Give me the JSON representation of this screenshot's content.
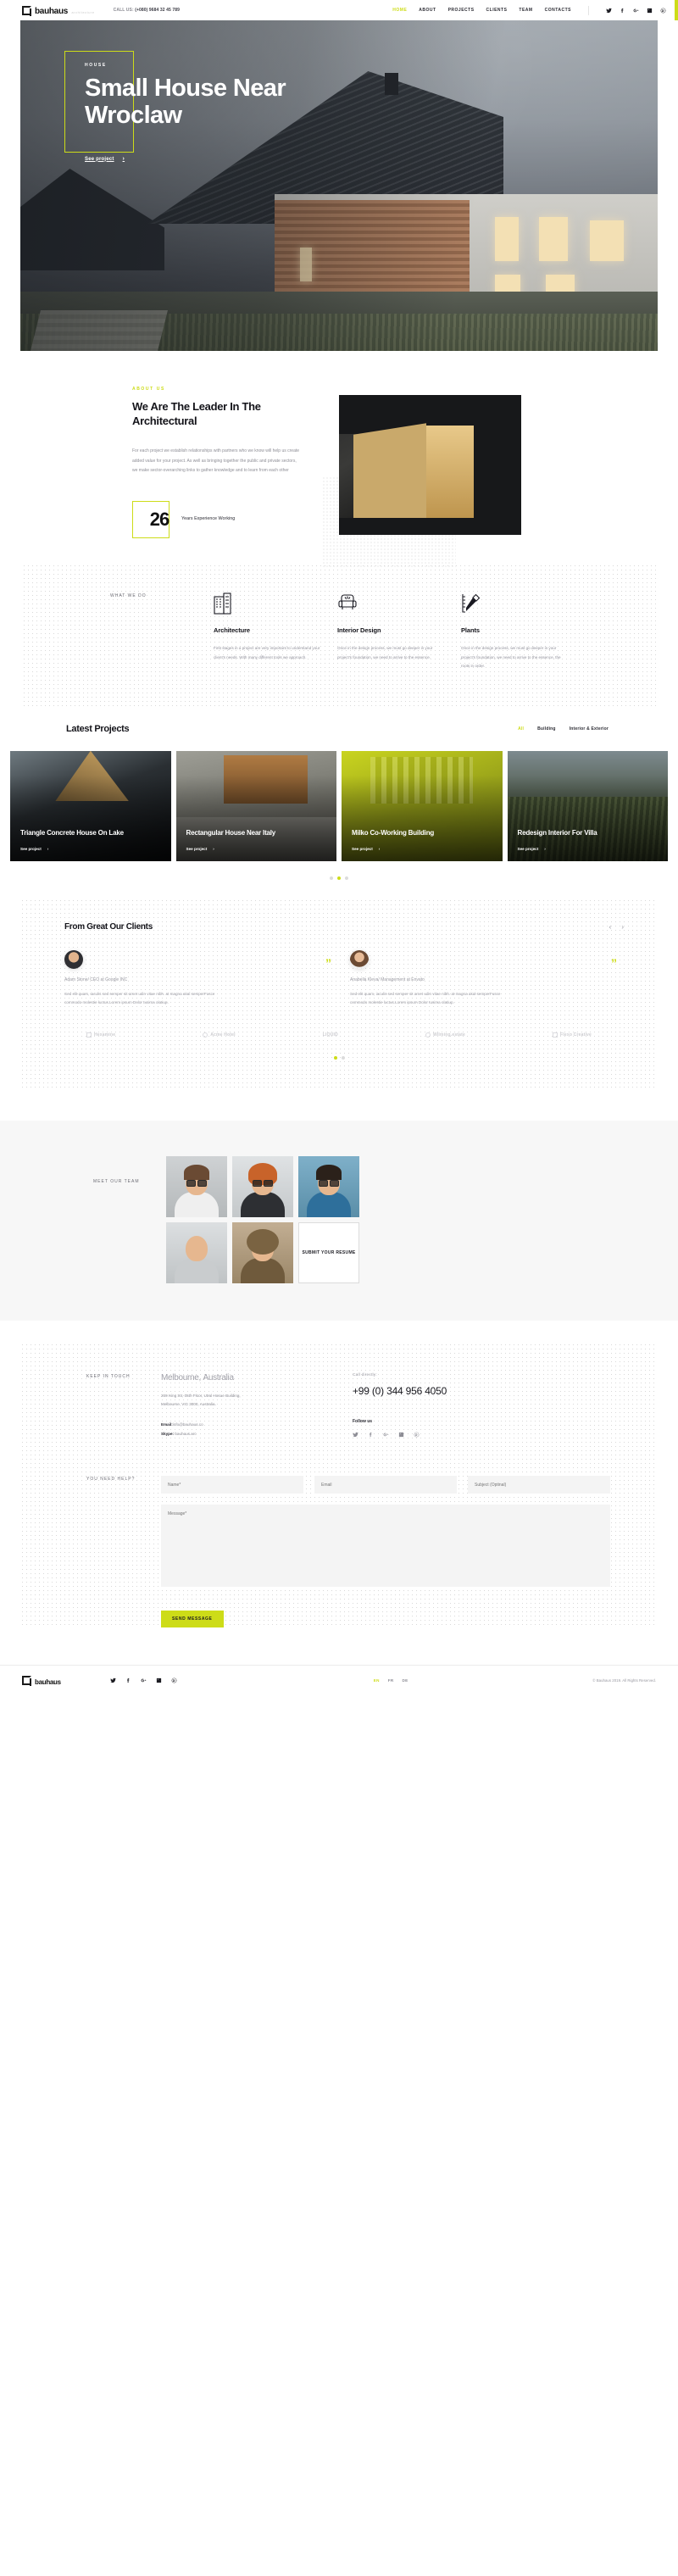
{
  "brand": {
    "name": "bauhaus",
    "tagline": "architecture"
  },
  "header": {
    "call_label": "CALL US:",
    "call_number": "(+080) 9684 32 45 789",
    "nav": [
      {
        "label": "HOME",
        "active": true
      },
      {
        "label": "ABOUT",
        "active": false
      },
      {
        "label": "PROJECTS",
        "active": false
      },
      {
        "label": "CLIENTS",
        "active": false
      },
      {
        "label": "TEAM",
        "active": false
      },
      {
        "label": "CONTACTS",
        "active": false
      }
    ],
    "socials": [
      "twitter-icon",
      "facebook-icon",
      "google-plus-icon",
      "linkedin-icon",
      "behance-icon"
    ],
    "accent_color": "#cddc18"
  },
  "hero": {
    "eyebrow": "HOUSE",
    "title": "Small House Near Wroclaw",
    "cta": "See project",
    "cta_arrow": "›"
  },
  "about": {
    "eyebrow": "ABOUT US",
    "title": "We Are The Leader In The Architectural",
    "body": "For each project we establish relationships with partners who we know will help us create added value for your project. As well as bringing together the public and private sectors, we make sector-overarching links to gather knowledge and to learn from each other",
    "years_number": "26",
    "years_label": "Years Experience Working"
  },
  "services": {
    "head": "WHAT WE DO",
    "items": [
      {
        "icon": "building-icon",
        "title": "Architecture",
        "text": "First stages in a project are very important to understand your client's needs. With many different tools we approach."
      },
      {
        "icon": "armchair-icon",
        "title": "Interior Design",
        "text": "Once in the design process, we must go deeper in your project's foundation, we need to arrive to the essence."
      },
      {
        "icon": "drafting-icon",
        "title": "Plants",
        "text": "Once in the design process, we must go deeper in your project's foundation, we need to arrive to the essence, the roots in order."
      }
    ]
  },
  "projects": {
    "title": "Latest Projects",
    "filters": [
      {
        "label": "All",
        "active": true
      },
      {
        "label": "Building",
        "active": false
      },
      {
        "label": "Interior & Exterior",
        "active": false
      }
    ],
    "cta": "See project",
    "cards": [
      {
        "title": "Triangle Concrete House On Lake"
      },
      {
        "title": "Rectangular House Near Italy"
      },
      {
        "title": "Milko Co-Working Building"
      },
      {
        "title": "Redesign Interior For Villa"
      }
    ],
    "pager": [
      false,
      true,
      false
    ]
  },
  "testimonials": {
    "title": "From Great Our Clients",
    "prev": "‹",
    "next": "›",
    "quote_glyph": "”",
    "items": [
      {
        "name": "Adam Stone",
        "role": "/ CEO at Google INC",
        "text": "Sed elit quam, iaculis sed semper sit amet udin vitae nibh. at magna akal semperFusce commodo molestie luctus.Lorem ipsum Dolor tusima olatiup."
      },
      {
        "name": "Anabella Kleva",
        "role": "/ Management at Envato",
        "text": "Sed elit quam, iaculis sed semper sit amet udin vitae nibh. at magna akal semperFusce commodo molestie luctus.Lorem ipsum Dolor tusima olatiup."
      }
    ],
    "logos": [
      "Hexamine",
      "Acme Hotel",
      "LIQUID",
      "Wilming.estate",
      "Flexo Creative"
    ],
    "pager": [
      true,
      false
    ]
  },
  "team": {
    "head": "MEET OUR TEAM",
    "members": [
      "member-1",
      "member-2",
      "member-3",
      "member-4",
      "member-5"
    ],
    "submit_label": "SUBMIT YOUR RESUME"
  },
  "contact": {
    "keep_in_touch": "KEEP IN TOUCH",
    "city": "Melbourne,",
    "country": "Australia",
    "address_line1": "269 King Str, 05th Floor, Utral Hosue Building,",
    "address_line2": "Melbourne, VIC 3000, Australia.",
    "email_label": "Email:",
    "email_value": "info@bauhaus.co",
    "skype_label": "Skype:",
    "skype_value": "bauhaus.arc",
    "call_label": "Call directly:",
    "call_number": "+99 (0) 344 956 4050",
    "follow_label": "Follow us",
    "follow_icons": [
      "twitter-icon",
      "facebook-icon",
      "google-plus-icon",
      "linkedin-icon",
      "behance-icon"
    ]
  },
  "form": {
    "head": "YOU NEED HELP?",
    "name_placeholder": "Name*",
    "email_placeholder": "Email",
    "subject_placeholder": "Subject (Optinal)",
    "message_placeholder": "Message*",
    "submit_label": "SEND MESSAGE"
  },
  "footer": {
    "socials": [
      "twitter-icon",
      "facebook-icon",
      "google-plus-icon",
      "linkedin-icon",
      "behance-icon"
    ],
    "langs": [
      {
        "label": "EN",
        "active": true
      },
      {
        "label": "FR",
        "active": false
      },
      {
        "label": "DE",
        "active": false
      }
    ],
    "copyright": "© Bauhaus 2019. All Rights Reserved."
  }
}
